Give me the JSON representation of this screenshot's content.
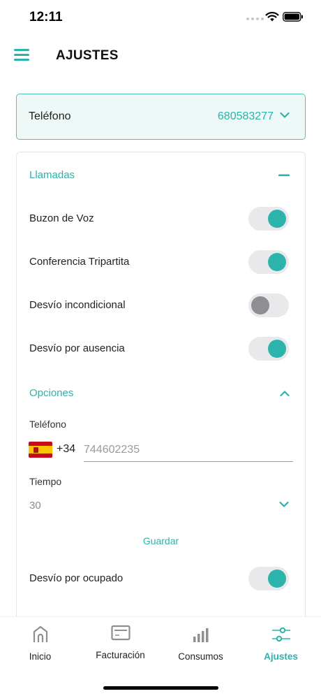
{
  "status_bar": {
    "time": "12:11"
  },
  "header": {
    "title": "AJUSTES"
  },
  "phone_selector": {
    "label": "Teléfono",
    "value": "680583277"
  },
  "llamadas": {
    "title": "Llamadas",
    "settings": [
      {
        "label": "Buzon de Voz",
        "enabled": true
      },
      {
        "label": "Conferencia Tripartita",
        "enabled": true
      },
      {
        "label": "Desvío incondicional",
        "enabled": false
      },
      {
        "label": "Desvío por ausencia",
        "enabled": true
      }
    ]
  },
  "opciones": {
    "title": "Opciones",
    "phone_label": "Teléfono",
    "dial_code": "+34",
    "phone_placeholder": "744602235",
    "time_label": "Tiempo",
    "time_value": "30",
    "save_label": "Guardar"
  },
  "desvio_ocupado": {
    "label": "Desvío por ocupado",
    "enabled": true
  },
  "bottom_nav": {
    "items": [
      {
        "label": "Inicio",
        "icon": "home-icon",
        "active": false
      },
      {
        "label": "Facturación",
        "icon": "billing-card-icon",
        "active": false
      },
      {
        "label": "Consumos",
        "icon": "bar-chart-icon",
        "active": false
      },
      {
        "label": "Ajustes",
        "icon": "sliders-icon",
        "active": true
      }
    ]
  },
  "colors": {
    "accent": "#2bb3ac",
    "selector_bg": "#edf8f7",
    "toggle_off": "#8e8e93"
  }
}
